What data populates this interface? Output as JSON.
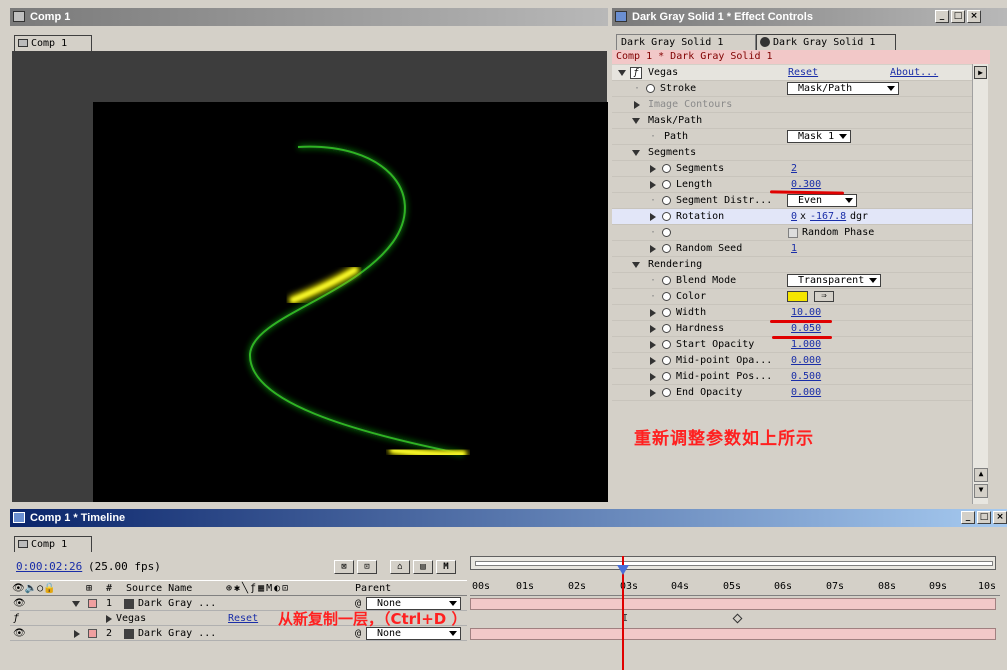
{
  "comp_window": {
    "title": "Comp 1",
    "tab": "Comp 1"
  },
  "effect_window": {
    "title": "Dark Gray Solid 1 * Effect Controls",
    "tabs": [
      "Dark Gray Solid 1",
      "Dark Gray Solid 1"
    ],
    "breadcrumb": "Comp 1 * Dark Gray Solid 1",
    "effect": {
      "name": "Vegas",
      "reset": "Reset",
      "about": "About..."
    },
    "rows": {
      "stroke": {
        "label": "Stroke",
        "value": "Mask/Path"
      },
      "image_contours": "Image Contours",
      "mask_path": "Mask/Path",
      "path": {
        "label": "Path",
        "value": "Mask 1"
      },
      "segments_group": "Segments",
      "segments": {
        "label": "Segments",
        "value": "2"
      },
      "length": {
        "label": "Length",
        "value": "0.300"
      },
      "segment_distr": {
        "label": "Segment Distr...",
        "value": "Even"
      },
      "rotation": {
        "label": "Rotation",
        "rev": "0",
        "x": "x",
        "deg": "-167.8",
        "unit": "dgr"
      },
      "random_phase": "Random Phase",
      "random_seed": {
        "label": "Random Seed",
        "value": "1"
      },
      "rendering": "Rendering",
      "blend_mode": {
        "label": "Blend Mode",
        "value": "Transparent"
      },
      "color": {
        "label": "Color",
        "swatch": "#f5e600"
      },
      "width": {
        "label": "Width",
        "value": "10.00"
      },
      "hardness": {
        "label": "Hardness",
        "value": "0.050"
      },
      "start_opacity": {
        "label": "Start Opacity",
        "value": "1.000"
      },
      "midpoint_opa": {
        "label": "Mid-point Opa...",
        "value": "0.000"
      },
      "midpoint_pos": {
        "label": "Mid-point Pos...",
        "value": "0.500"
      },
      "end_opacity": {
        "label": "End Opacity",
        "value": "0.000"
      }
    },
    "annotation": "重新调整参数如上所示"
  },
  "timeline": {
    "title": "Comp 1 * Timeline",
    "tab": "Comp 1",
    "timecode": "0:00:02:26",
    "fps": "(25.00 fps)",
    "headers": {
      "num": "#",
      "source": "Source Name",
      "parent": "Parent"
    },
    "ruler": [
      "00s",
      "01s",
      "02s",
      "03s",
      "04s",
      "05s",
      "06s",
      "07s",
      "08s",
      "09s",
      "10s"
    ],
    "layers": [
      {
        "num": "1",
        "name": "Dark Gray ...",
        "parent": "None"
      },
      {
        "name": "Vegas",
        "reset": "Reset"
      },
      {
        "num": "2",
        "name": "Dark Gray ...",
        "parent": "None"
      }
    ],
    "annotation": "从新复制一层，（Ctrl+D  ）",
    "m_button": "M",
    "playhead_fraction": 0.296
  }
}
